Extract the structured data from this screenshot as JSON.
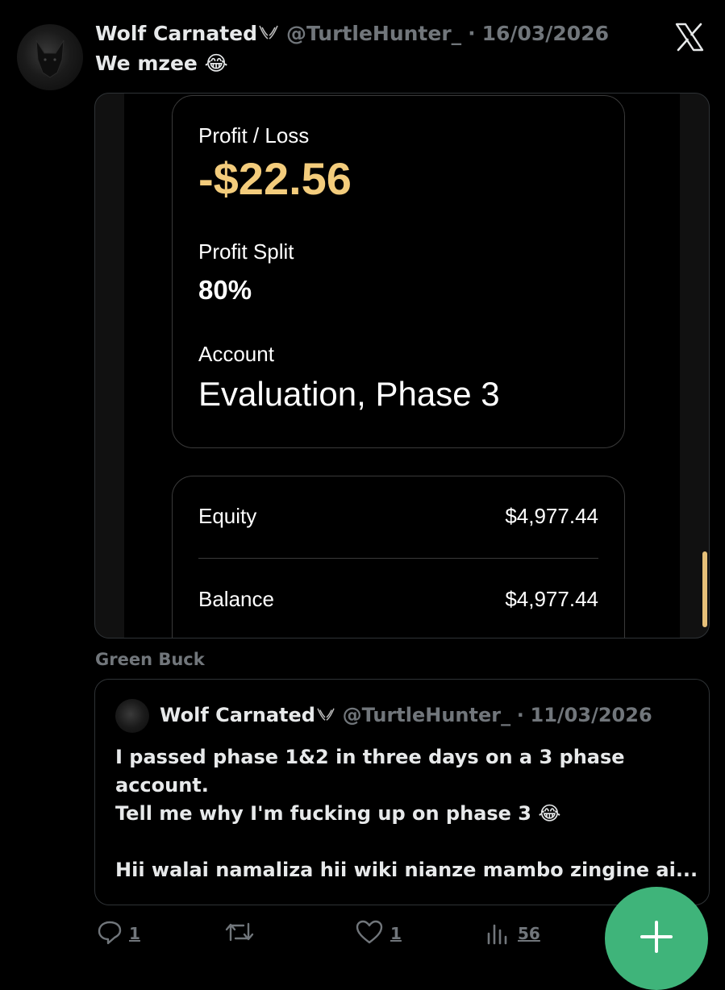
{
  "tweet": {
    "author_name": "Wolf Carnated",
    "author_handle": "@TurtleHunter_",
    "separator": "·",
    "date": "16/03/2026",
    "text": "We mzee 😂"
  },
  "media": {
    "profit_loss_label": "Profit / Loss",
    "profit_loss_value": "-$22.56",
    "profit_split_label": "Profit Split",
    "profit_split_value": "80%",
    "account_label": "Account",
    "account_value": "Evaluation, Phase 3",
    "equity_label": "Equity",
    "equity_value": "$4,977.44",
    "balance_label": "Balance",
    "balance_value": "$4,977.44",
    "accent_color": "#f3cc7c"
  },
  "sub_caption": "Green Buck",
  "quoted_tweet": {
    "author_name": "Wolf Carnated",
    "author_handle": "@TurtleHunter_",
    "separator": "·",
    "date": "11/03/2026",
    "lines": [
      "I passed phase 1&2 in three days on a 3 phase",
      "account.",
      "Tell me why I'm fucking up on phase 3 😂",
      "Hii walai namaliza hii wiki nianze mambo zingine ai..."
    ]
  },
  "actions": {
    "reply_count": "1",
    "like_count": "1",
    "views_count": "56"
  },
  "icons": {
    "brand": "x-logo-icon",
    "reply": "reply-icon",
    "retweet": "retweet-icon",
    "like": "heart-icon",
    "views": "views-icon",
    "compose": "plus-icon"
  },
  "colors": {
    "background": "#000000",
    "muted": "#71767b",
    "fab": "#3fb47a"
  }
}
